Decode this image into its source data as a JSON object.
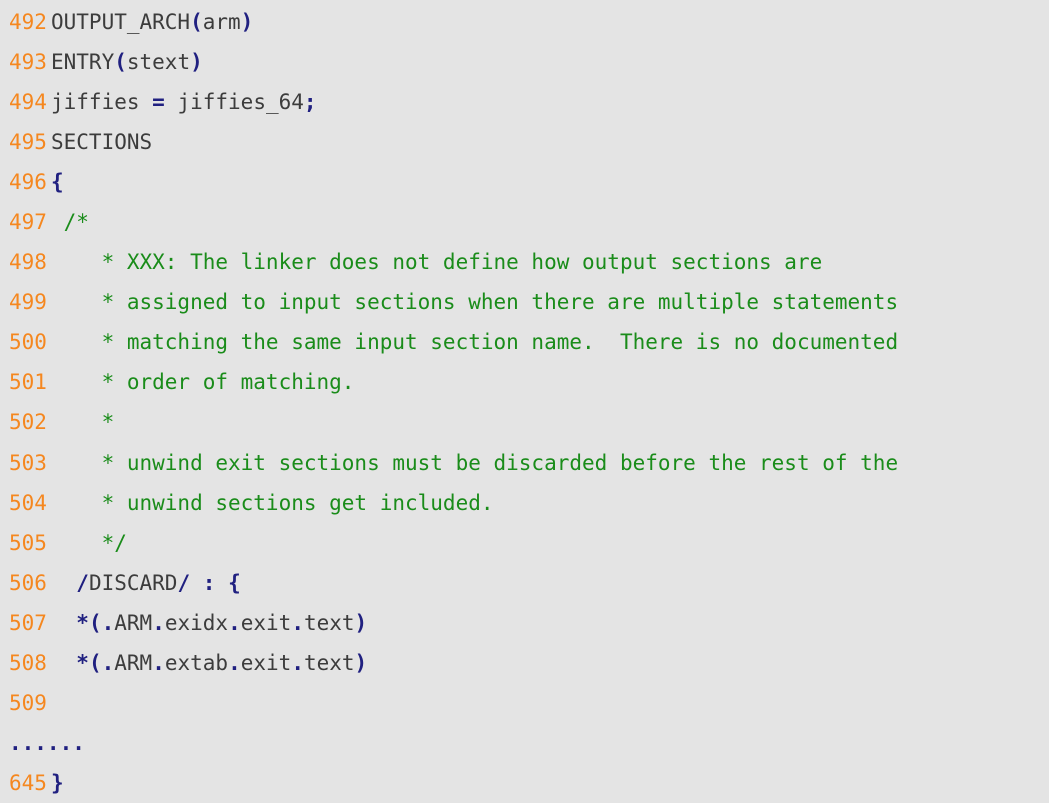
{
  "listing": {
    "language": "linker-script",
    "colors": {
      "background": "#e4e4e4",
      "line_number": "#f5871f",
      "code_text": "#3c3c3c",
      "comment": "#1a8c1a",
      "punctuation": "#202080"
    },
    "ellipsis_row": "......",
    "lines": [
      {
        "number": "492",
        "text": "OUTPUT_ARCH(arm)",
        "tokens": [
          {
            "t": "OUTPUT_ARCH",
            "k": "plain"
          },
          {
            "t": "(",
            "k": "punc"
          },
          {
            "t": "arm",
            "k": "plain"
          },
          {
            "t": ")",
            "k": "punc"
          }
        ]
      },
      {
        "number": "493",
        "text": "ENTRY(stext)",
        "tokens": [
          {
            "t": "ENTRY",
            "k": "plain"
          },
          {
            "t": "(",
            "k": "punc"
          },
          {
            "t": "stext",
            "k": "plain"
          },
          {
            "t": ")",
            "k": "punc"
          }
        ]
      },
      {
        "number": "494",
        "text": "jiffies = jiffies_64;",
        "tokens": [
          {
            "t": "jiffies ",
            "k": "plain"
          },
          {
            "t": "=",
            "k": "punc"
          },
          {
            "t": " jiffies_64",
            "k": "plain"
          },
          {
            "t": ";",
            "k": "punc"
          }
        ]
      },
      {
        "number": "495",
        "text": "SECTIONS",
        "tokens": [
          {
            "t": "SECTIONS",
            "k": "plain"
          }
        ]
      },
      {
        "number": "496",
        "text": "{",
        "tokens": [
          {
            "t": "{",
            "k": "punc"
          }
        ]
      },
      {
        "number": "497",
        "text": " /*",
        "tokens": [
          {
            "t": " /*",
            "k": "comment"
          }
        ]
      },
      {
        "number": "498",
        "text": "    * XXX: The linker does not define how output sections are",
        "tokens": [
          {
            "t": "    * XXX: The linker does not define how output sections are",
            "k": "comment"
          }
        ]
      },
      {
        "number": "499",
        "text": "    * assigned to input sections when there are multiple statements",
        "tokens": [
          {
            "t": "    * assigned to input sections when there are multiple statements",
            "k": "comment"
          }
        ]
      },
      {
        "number": "500",
        "text": "    * matching the same input section name.  There is no documented",
        "tokens": [
          {
            "t": "    * matching the same input section name.  There is no documented",
            "k": "comment"
          }
        ]
      },
      {
        "number": "501",
        "text": "    * order of matching.",
        "tokens": [
          {
            "t": "    * order of matching.",
            "k": "comment"
          }
        ]
      },
      {
        "number": "502",
        "text": "    *",
        "tokens": [
          {
            "t": "    *",
            "k": "comment"
          }
        ]
      },
      {
        "number": "503",
        "text": "    * unwind exit sections must be discarded before the rest of the",
        "tokens": [
          {
            "t": "    * unwind exit sections must be discarded before the rest of the",
            "k": "comment"
          }
        ]
      },
      {
        "number": "504",
        "text": "    * unwind sections get included.",
        "tokens": [
          {
            "t": "    * unwind sections get included.",
            "k": "comment"
          }
        ]
      },
      {
        "number": "505",
        "text": "    */",
        "tokens": [
          {
            "t": "    */",
            "k": "comment"
          }
        ]
      },
      {
        "number": "506",
        "text": "  /DISCARD/ : {",
        "tokens": [
          {
            "t": "  ",
            "k": "plain"
          },
          {
            "t": "/",
            "k": "punc"
          },
          {
            "t": "DISCARD",
            "k": "plain"
          },
          {
            "t": "/",
            "k": "punc"
          },
          {
            "t": " ",
            "k": "plain"
          },
          {
            "t": ":",
            "k": "punc"
          },
          {
            "t": " ",
            "k": "plain"
          },
          {
            "t": "{",
            "k": "punc"
          }
        ]
      },
      {
        "number": "507",
        "text": "  *(.ARM.exidx.exit.text)",
        "tokens": [
          {
            "t": "  ",
            "k": "plain"
          },
          {
            "t": "*",
            "k": "punc"
          },
          {
            "t": "(",
            "k": "punc"
          },
          {
            "t": ".",
            "k": "punc"
          },
          {
            "t": "ARM",
            "k": "plain"
          },
          {
            "t": ".",
            "k": "punc"
          },
          {
            "t": "exidx",
            "k": "plain"
          },
          {
            "t": ".",
            "k": "punc"
          },
          {
            "t": "exit",
            "k": "plain"
          },
          {
            "t": ".",
            "k": "punc"
          },
          {
            "t": "text",
            "k": "plain"
          },
          {
            "t": ")",
            "k": "punc"
          }
        ]
      },
      {
        "number": "508",
        "text": "  *(.ARM.extab.exit.text)",
        "tokens": [
          {
            "t": "  ",
            "k": "plain"
          },
          {
            "t": "*",
            "k": "punc"
          },
          {
            "t": "(",
            "k": "punc"
          },
          {
            "t": ".",
            "k": "punc"
          },
          {
            "t": "ARM",
            "k": "plain"
          },
          {
            "t": ".",
            "k": "punc"
          },
          {
            "t": "extab",
            "k": "plain"
          },
          {
            "t": ".",
            "k": "punc"
          },
          {
            "t": "exit",
            "k": "plain"
          },
          {
            "t": ".",
            "k": "punc"
          },
          {
            "t": "text",
            "k": "plain"
          },
          {
            "t": ")",
            "k": "punc"
          }
        ]
      },
      {
        "number": "509",
        "text": "",
        "tokens": []
      },
      {
        "number": "645",
        "text": "}",
        "tokens": [
          {
            "t": "}",
            "k": "punc"
          }
        ]
      }
    ]
  }
}
